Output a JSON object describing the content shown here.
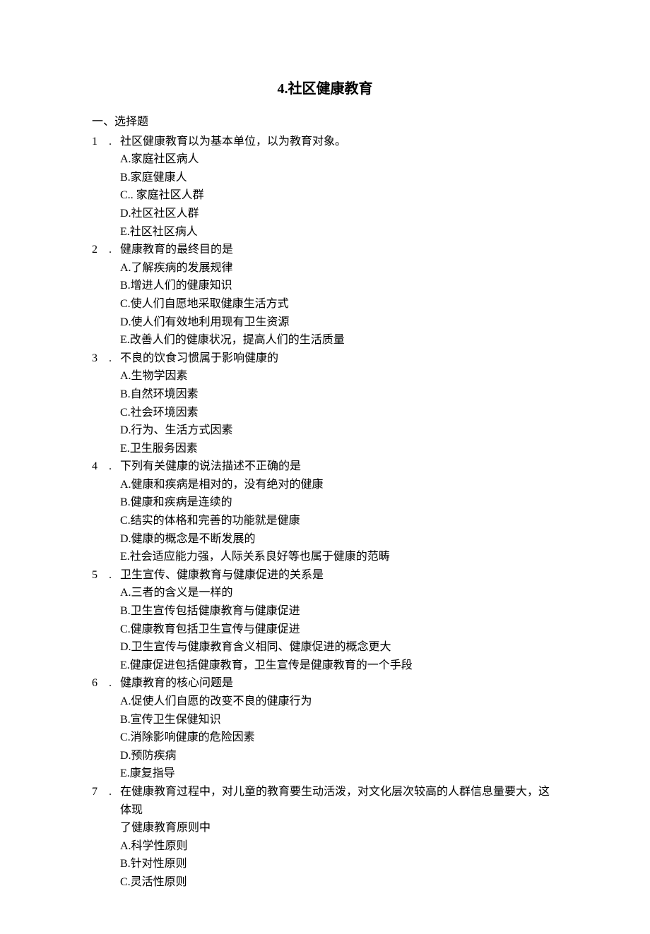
{
  "title": "4.社区健康教育",
  "section_header": "一、选择题",
  "questions": [
    {
      "num": "1",
      "dot": ".",
      "stem": "社区健康教育以为基本单位，以为教育对象。",
      "options": [
        "A.家庭社区病人",
        "B.家庭健康人",
        "C.. 家庭社区人群",
        "D.社区社区人群",
        "E.社区社区病人"
      ]
    },
    {
      "num": "2",
      "dot": ".",
      "stem": " 健康教育的最终目的是",
      "options": [
        "A.了解疾病的发展规律",
        "B.增进人们的健康知识",
        "C.使人们自愿地采取健康生活方式",
        "D.使人们有效地利用现有卫生资源",
        "E.改善人们的健康状况，提高人们的生活质量"
      ]
    },
    {
      "num": "3",
      "dot": ".",
      "stem": "不良的饮食习惯属于影响健康的",
      "options": [
        "A.生物学因素",
        "B.自然环境因素",
        "C.社会环境因素",
        "D.行为、生活方式因素",
        "E.卫生服务因素"
      ]
    },
    {
      "num": "4",
      "dot": ".",
      "stem": "下列有关健康的说法描述不正确的是",
      "options": [
        "A.健康和疾病是相对的，没有绝对的健康",
        "B.健康和疾病是连续的",
        "C.结实的体格和完善的功能就是健康",
        "D.健康的概念是不断发展的",
        "E.社会适应能力强，人际关系良好等也属于健康的范畴"
      ]
    },
    {
      "num": "5",
      "dot": ".",
      "stem": "卫生宣传、健康教育与健康促进的关系是",
      "options": [
        "A.三者的含义是一样的",
        "B.卫生宣传包括健康教育与健康促进",
        "C.健康教育包括卫生宣传与健康促进",
        "D.卫生宣传与健康教育含义相同、健康促进的概念更大",
        "E.健康促进包括健康教育，卫生宣传是健康教育的一个手段"
      ]
    },
    {
      "num": "6",
      "dot": ".",
      "stem": " 健康教育的核心问题是",
      "options": [
        "A.促使人们自愿的改变不良的健康行为",
        "B.宣传卫生保健知识",
        "C.消除影响健康的危险因素",
        "D.预防疾病",
        "E.康复指导"
      ]
    },
    {
      "num": "7",
      "dot": ".",
      "stem": "在健康教育过程中，对儿童的教育要生动活泼，对文化层次较高的人群信息量要大，这体现",
      "continuation": "了健康教育原则中",
      "options": [
        "A.科学性原则",
        "B.针对性原则",
        "C.灵活性原则"
      ]
    }
  ]
}
